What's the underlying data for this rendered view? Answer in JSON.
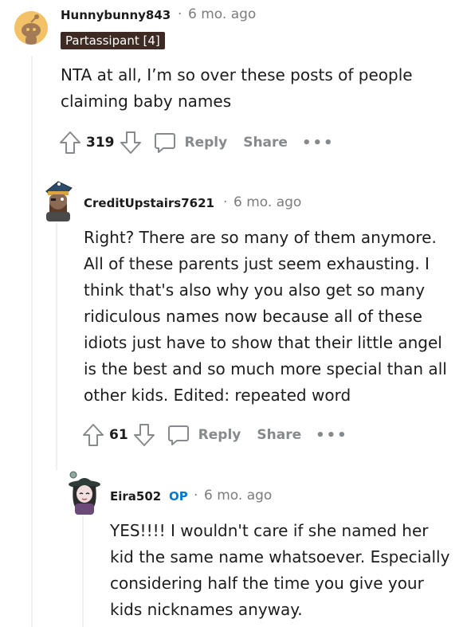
{
  "comments": [
    {
      "username": "Hunnybunny843",
      "time": "6 mo. ago",
      "separator": "·",
      "flair": "Partassipant [4]",
      "lines": [
        "NTA at all, I’m so over these posts of people",
        "claiming baby names"
      ],
      "score": "319",
      "reply_label": "Reply",
      "share_label": "Share",
      "more_label": "•••"
    },
    {
      "username": "CreditUpstairs7621",
      "time": "6 mo. ago",
      "separator": "·",
      "lines": [
        "Right? There are so many of them anymore.",
        "All of these parents just seem exhausting. I",
        "think that's also why you also get so many",
        "ridiculous names now because all of these",
        "idiots just have to show that their little angel",
        "is the best and so much more special than all",
        "other kids. Edited: repeated word"
      ],
      "score": "61",
      "reply_label": "Reply",
      "share_label": "Share",
      "more_label": "•••"
    },
    {
      "username": "Eira502",
      "op_badge": "OP",
      "time": "6 mo. ago",
      "separator": "·",
      "lines": [
        "YES!!!! I wouldn't care if she named her",
        "kid the same name whatsoever. Especially",
        "considering half the time you give your",
        "kids nicknames anyway."
      ]
    }
  ]
}
